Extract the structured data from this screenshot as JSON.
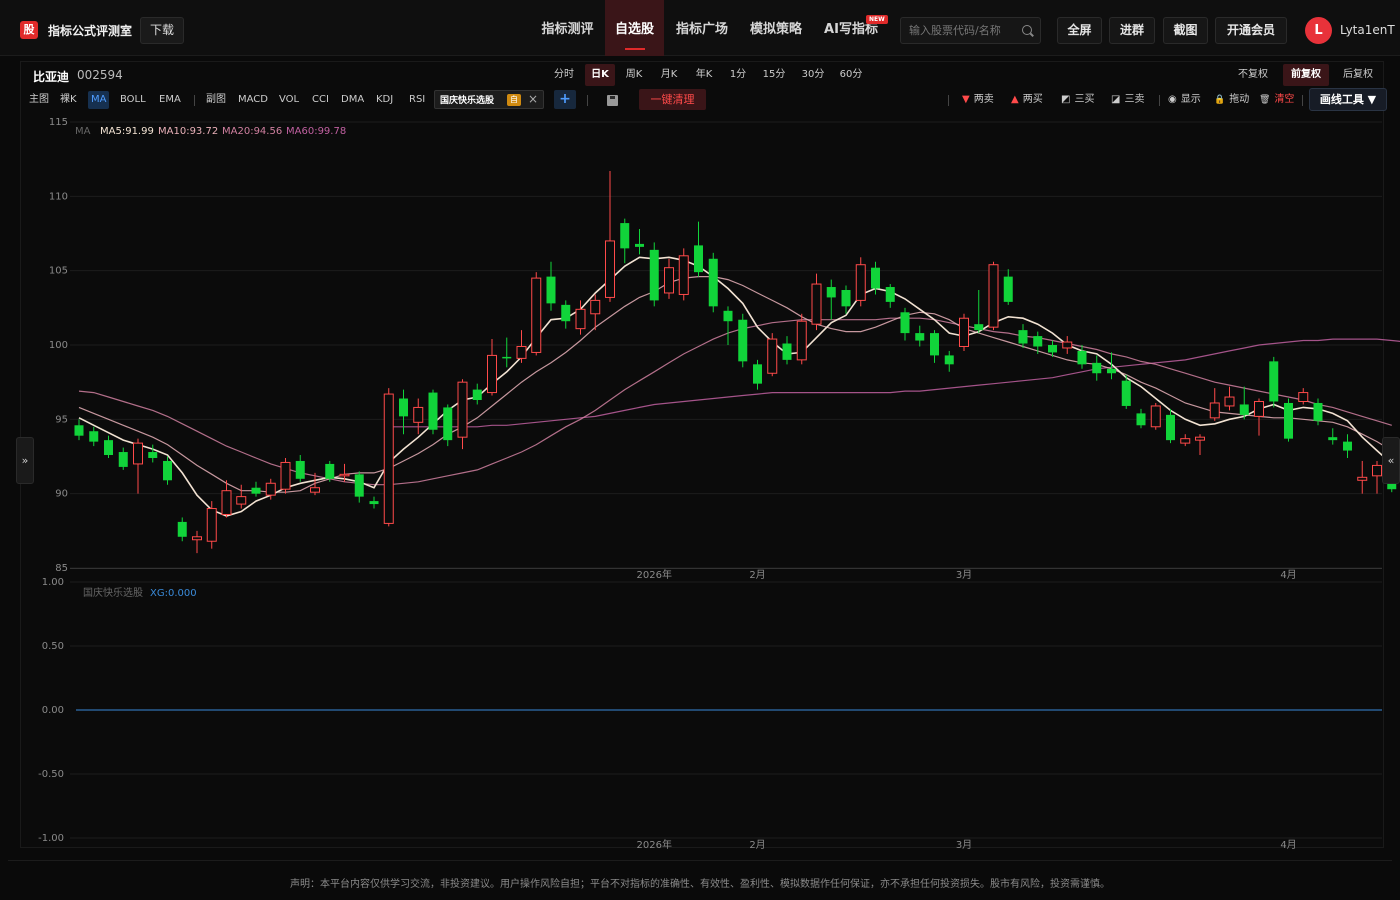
{
  "app": {
    "logo_char": "股",
    "title": "指标公式评测室",
    "download_label": "下载"
  },
  "nav": {
    "items": [
      "指标测评",
      "自选股",
      "指标广场",
      "模拟策略",
      "AI写指标"
    ],
    "active_index": 1,
    "new_badge": "NEW"
  },
  "search": {
    "placeholder": "输入股票代码/名称"
  },
  "top_buttons": [
    "全屏",
    "进群",
    "截图",
    "开通会员"
  ],
  "user": {
    "avatar_letter": "L",
    "name": "Lyta1enT"
  },
  "stock": {
    "name": "比亚迪",
    "code": "002594"
  },
  "periods": [
    "分时",
    "日K",
    "周K",
    "月K",
    "年K",
    "1分",
    "15分",
    "30分",
    "60分"
  ],
  "period_active": "日K",
  "adjust": [
    "不复权",
    "前复权",
    "后复权"
  ],
  "adjust_active": "前复权",
  "indicators_main": [
    "主图",
    "裸K",
    "MA",
    "BOLL",
    "EMA"
  ],
  "indicators_main_active": "MA",
  "indicators_sub": [
    "副图",
    "MACD",
    "VOL",
    "CCI",
    "DMA",
    "KDJ",
    "RSI"
  ],
  "custom_indicator": {
    "name": "国庆快乐选股",
    "badge": "自",
    "close": "×"
  },
  "add_indicator": "+",
  "clear_all": "一键清理",
  "draw_tools": [
    {
      "icon": "▼",
      "color": "#ff4a4a",
      "label": "两卖"
    },
    {
      "icon": "▲",
      "color": "#ff4a4a",
      "label": "两买"
    },
    {
      "icon": "◩",
      "color": "#cccccc",
      "label": "三买"
    },
    {
      "icon": "◪",
      "color": "#cccccc",
      "label": "三卖"
    },
    {
      "icon": "◉",
      "color": "#cccccc",
      "label": "显示"
    },
    {
      "icon": "🔒",
      "color": "#e0a030",
      "label": "拖动"
    },
    {
      "icon": "🗑",
      "color": "#cccccc",
      "label": "清空"
    }
  ],
  "draw_tools_button": "画线工具 ▼",
  "ma_legend": {
    "label": "MA",
    "items": [
      {
        "text": "MA5:91.99",
        "color": "#f2e2d2"
      },
      {
        "text": "MA10:93.72",
        "color": "#e8b0b8"
      },
      {
        "text": "MA20:94.56",
        "color": "#d080a0"
      },
      {
        "text": "MA60:99.78",
        "color": "#c060a0"
      }
    ]
  },
  "sub_legend": {
    "name": "国庆快乐选股",
    "value": "XG:0.000"
  },
  "collapse_left": "»",
  "collapse_right": "«",
  "disclaimer": "声明：本平台内容仅供学习交流，非投资建议。用户操作风险自担；平台不对指标的准确性、有效性、盈利性、模拟数据作任何保证，亦不承担任何投资损失。股市有风险，投资需谨慎。",
  "colors": {
    "up": "#ff4a4a",
    "down": "#11d43a",
    "accent": "#e02a2a",
    "ma5": "#f2e2d2",
    "ma10": "#e8b0b8",
    "ma20": "#d080a0",
    "ma60": "#c060a0",
    "xg": "#3a8ad8"
  },
  "chart_data": [
    {
      "type": "candlestick",
      "ylim": [
        85,
        115
      ],
      "y_ticks": [
        115,
        110,
        105,
        100,
        95,
        90,
        85
      ],
      "x_labels": [
        {
          "label": "2026年",
          "index": 39
        },
        {
          "label": "2月",
          "index": 46
        },
        {
          "label": "3月",
          "index": 60
        },
        {
          "label": "4月",
          "index": 82
        }
      ],
      "candles": [
        {
          "o": 94.6,
          "c": 93.9,
          "h": 95.0,
          "l": 93.6
        },
        {
          "o": 94.2,
          "c": 93.5,
          "h": 94.5,
          "l": 93.2
        },
        {
          "o": 93.6,
          "c": 92.6,
          "h": 93.9,
          "l": 92.4
        },
        {
          "o": 92.8,
          "c": 91.8,
          "h": 93.1,
          "l": 91.6
        },
        {
          "o": 92.0,
          "c": 93.4,
          "h": 93.7,
          "l": 90.0
        },
        {
          "o": 92.8,
          "c": 92.4,
          "h": 93.3,
          "l": 92.1
        },
        {
          "o": 92.2,
          "c": 90.9,
          "h": 92.5,
          "l": 90.6
        },
        {
          "o": 88.1,
          "c": 87.1,
          "h": 88.4,
          "l": 86.8
        },
        {
          "o": 86.9,
          "c": 87.1,
          "h": 87.5,
          "l": 86.0
        },
        {
          "o": 86.8,
          "c": 89.0,
          "h": 89.5,
          "l": 86.3
        },
        {
          "o": 88.6,
          "c": 90.2,
          "h": 90.9,
          "l": 88.4
        },
        {
          "o": 89.3,
          "c": 89.8,
          "h": 90.6,
          "l": 89.0
        },
        {
          "o": 90.4,
          "c": 90.0,
          "h": 90.8,
          "l": 89.8
        },
        {
          "o": 89.9,
          "c": 90.7,
          "h": 91.0,
          "l": 89.6
        },
        {
          "o": 90.3,
          "c": 92.1,
          "h": 92.4,
          "l": 90.0
        },
        {
          "o": 92.2,
          "c": 91.0,
          "h": 92.6,
          "l": 90.8
        },
        {
          "o": 90.1,
          "c": 90.4,
          "h": 91.4,
          "l": 89.9
        },
        {
          "o": 92.0,
          "c": 91.0,
          "h": 92.2,
          "l": 90.8
        },
        {
          "o": 91.2,
          "c": 91.3,
          "h": 92.0,
          "l": 90.8
        },
        {
          "o": 91.3,
          "c": 89.8,
          "h": 91.5,
          "l": 89.4
        },
        {
          "o": 89.5,
          "c": 89.3,
          "h": 89.8,
          "l": 89.0
        },
        {
          "o": 88.0,
          "c": 96.7,
          "h": 97.1,
          "l": 87.8
        },
        {
          "o": 96.4,
          "c": 95.2,
          "h": 97.0,
          "l": 94.0
        },
        {
          "o": 94.8,
          "c": 95.8,
          "h": 96.4,
          "l": 94.0
        },
        {
          "o": 96.8,
          "c": 94.3,
          "h": 97.0,
          "l": 94.0
        },
        {
          "o": 95.8,
          "c": 93.6,
          "h": 96.0,
          "l": 93.2
        },
        {
          "o": 93.8,
          "c": 97.5,
          "h": 97.7,
          "l": 93.0
        },
        {
          "o": 97.0,
          "c": 96.3,
          "h": 97.4,
          "l": 96.0
        },
        {
          "o": 96.8,
          "c": 99.3,
          "h": 100.4,
          "l": 96.6
        },
        {
          "o": 99.2,
          "c": 99.1,
          "h": 100.5,
          "l": 98.5
        },
        {
          "o": 99.1,
          "c": 99.9,
          "h": 101.0,
          "l": 98.8
        },
        {
          "o": 99.5,
          "c": 104.5,
          "h": 104.9,
          "l": 99.3
        },
        {
          "o": 104.6,
          "c": 102.8,
          "h": 105.6,
          "l": 102.3
        },
        {
          "o": 102.7,
          "c": 101.6,
          "h": 103.0,
          "l": 101.1
        },
        {
          "o": 101.1,
          "c": 102.4,
          "h": 103.0,
          "l": 100.7
        },
        {
          "o": 102.1,
          "c": 103.0,
          "h": 103.4,
          "l": 101.0
        },
        {
          "o": 103.2,
          "c": 107.0,
          "h": 111.7,
          "l": 102.9
        },
        {
          "o": 108.2,
          "c": 106.5,
          "h": 108.5,
          "l": 105.5
        },
        {
          "o": 106.8,
          "c": 106.6,
          "h": 107.8,
          "l": 106.1
        },
        {
          "o": 106.4,
          "c": 103.0,
          "h": 106.9,
          "l": 102.6
        },
        {
          "o": 103.5,
          "c": 105.2,
          "h": 105.8,
          "l": 103.1
        },
        {
          "o": 103.4,
          "c": 106.0,
          "h": 106.5,
          "l": 103.0
        },
        {
          "o": 106.7,
          "c": 104.9,
          "h": 108.3,
          "l": 104.6
        },
        {
          "o": 105.8,
          "c": 102.6,
          "h": 106.2,
          "l": 102.2
        },
        {
          "o": 102.3,
          "c": 101.6,
          "h": 102.6,
          "l": 100.0
        },
        {
          "o": 101.7,
          "c": 98.9,
          "h": 102.1,
          "l": 98.5
        },
        {
          "o": 98.7,
          "c": 97.4,
          "h": 99.0,
          "l": 97.0
        },
        {
          "o": 98.1,
          "c": 100.4,
          "h": 100.8,
          "l": 97.9
        },
        {
          "o": 100.1,
          "c": 99.0,
          "h": 100.6,
          "l": 98.7
        },
        {
          "o": 99.0,
          "c": 101.6,
          "h": 102.1,
          "l": 98.7
        },
        {
          "o": 101.4,
          "c": 104.1,
          "h": 104.8,
          "l": 101.0
        },
        {
          "o": 103.9,
          "c": 103.2,
          "h": 104.4,
          "l": 101.7
        },
        {
          "o": 103.7,
          "c": 102.6,
          "h": 104.0,
          "l": 102.1
        },
        {
          "o": 103.0,
          "c": 105.4,
          "h": 105.9,
          "l": 102.6
        },
        {
          "o": 105.2,
          "c": 103.8,
          "h": 105.6,
          "l": 103.4
        },
        {
          "o": 103.9,
          "c": 102.9,
          "h": 104.1,
          "l": 102.5
        },
        {
          "o": 102.2,
          "c": 100.8,
          "h": 102.5,
          "l": 100.3
        },
        {
          "o": 100.8,
          "c": 100.3,
          "h": 101.3,
          "l": 99.9
        },
        {
          "o": 100.8,
          "c": 99.3,
          "h": 101.0,
          "l": 98.8
        },
        {
          "o": 99.3,
          "c": 98.7,
          "h": 99.6,
          "l": 98.2
        },
        {
          "o": 99.9,
          "c": 101.8,
          "h": 102.1,
          "l": 99.6
        },
        {
          "o": 101.4,
          "c": 101.0,
          "h": 103.7,
          "l": 100.8
        },
        {
          "o": 101.2,
          "c": 105.4,
          "h": 105.6,
          "l": 101.0
        },
        {
          "o": 104.6,
          "c": 102.9,
          "h": 105.1,
          "l": 102.7
        },
        {
          "o": 101.0,
          "c": 100.1,
          "h": 101.4,
          "l": 99.8
        },
        {
          "o": 100.6,
          "c": 99.9,
          "h": 100.9,
          "l": 99.4
        },
        {
          "o": 100.0,
          "c": 99.5,
          "h": 100.3,
          "l": 99.2
        },
        {
          "o": 99.8,
          "c": 100.2,
          "h": 100.6,
          "l": 99.4
        },
        {
          "o": 99.6,
          "c": 98.7,
          "h": 100.0,
          "l": 98.4
        },
        {
          "o": 98.8,
          "c": 98.1,
          "h": 99.3,
          "l": 97.6
        },
        {
          "o": 98.4,
          "c": 98.1,
          "h": 99.5,
          "l": 97.7
        },
        {
          "o": 97.6,
          "c": 95.9,
          "h": 98.0,
          "l": 95.7
        },
        {
          "o": 95.4,
          "c": 94.6,
          "h": 95.7,
          "l": 94.4
        },
        {
          "o": 94.5,
          "c": 95.9,
          "h": 96.1,
          "l": 94.3
        },
        {
          "o": 95.3,
          "c": 93.6,
          "h": 95.7,
          "l": 93.4
        },
        {
          "o": 93.4,
          "c": 93.7,
          "h": 94.0,
          "l": 93.2
        },
        {
          "o": 93.6,
          "c": 93.8,
          "h": 94.0,
          "l": 92.6
        },
        {
          "o": 95.1,
          "c": 96.1,
          "h": 97.1,
          "l": 94.9
        },
        {
          "o": 95.9,
          "c": 96.5,
          "h": 97.2,
          "l": 95.6
        },
        {
          "o": 96.0,
          "c": 95.3,
          "h": 97.2,
          "l": 95.0
        },
        {
          "o": 95.2,
          "c": 96.2,
          "h": 96.4,
          "l": 93.9
        },
        {
          "o": 98.9,
          "c": 96.2,
          "h": 99.2,
          "l": 95.8
        },
        {
          "o": 96.1,
          "c": 93.7,
          "h": 96.4,
          "l": 93.5
        },
        {
          "o": 96.2,
          "c": 96.8,
          "h": 97.1,
          "l": 96.0
        },
        {
          "o": 96.1,
          "c": 94.9,
          "h": 96.4,
          "l": 94.6
        },
        {
          "o": 93.8,
          "c": 93.6,
          "h": 94.4,
          "l": 93.3
        },
        {
          "o": 93.5,
          "c": 92.9,
          "h": 94.0,
          "l": 92.4
        },
        {
          "o": 90.9,
          "c": 91.1,
          "h": 92.2,
          "l": 90.0
        },
        {
          "o": 91.2,
          "c": 91.9,
          "h": 92.2,
          "l": 90.0
        },
        {
          "o": 90.8,
          "c": 90.3,
          "h": 91.0,
          "l": 90.1
        }
      ],
      "ma5": [
        95.1,
        94.6,
        94.1,
        93.6,
        93.3,
        93.0,
        92.6,
        91.4,
        89.9,
        88.9,
        88.5,
        88.8,
        89.5,
        89.9,
        90.4,
        90.7,
        90.9,
        91.1,
        91.0,
        90.8,
        90.4,
        92.1,
        93.0,
        93.8,
        94.7,
        95.6,
        96.3,
        96.5,
        97.4,
        98.2,
        99.2,
        100.5,
        101.7,
        101.8,
        102.4,
        103.5,
        104.4,
        105.3,
        105.9,
        105.8,
        105.9,
        105.7,
        105.3,
        104.6,
        103.8,
        102.8,
        101.2,
        100.2,
        99.4,
        99.5,
        100.5,
        101.5,
        102.0,
        103.4,
        103.8,
        103.6,
        103.1,
        102.4,
        101.7,
        100.8,
        100.6,
        100.9,
        101.5,
        101.9,
        101.8,
        101.4,
        100.8,
        100.0,
        99.6,
        99.4,
        98.7,
        97.8,
        97.2,
        96.4,
        95.6,
        95.0,
        94.6,
        94.7,
        95.0,
        95.2,
        95.7,
        96.0,
        95.6,
        95.8,
        95.7,
        95.4,
        94.9,
        93.8,
        92.9,
        92.0
      ],
      "ma10": [
        95.8,
        95.4,
        95.0,
        94.6,
        94.2,
        93.8,
        93.3,
        92.6,
        91.9,
        91.3,
        90.7,
        90.2,
        90.2,
        90.1,
        90.1,
        90.2,
        90.7,
        91.0,
        91.3,
        91.4,
        91.4,
        91.7,
        92.2,
        92.7,
        93.3,
        94.0,
        94.5,
        95.1,
        95.9,
        96.7,
        97.5,
        98.2,
        98.8,
        99.5,
        100.3,
        101.2,
        101.9,
        102.6,
        103.2,
        103.6,
        104.2,
        104.5,
        104.6,
        104.6,
        104.4,
        104.0,
        103.5,
        103.0,
        102.5,
        101.9,
        101.4,
        101.1,
        100.9,
        100.9,
        101.2,
        101.6,
        102.0,
        102.2,
        102.1,
        101.7,
        101.1,
        100.8,
        100.5,
        100.2,
        99.9,
        99.6,
        99.3,
        99.0,
        98.8,
        98.7,
        98.4,
        98.0,
        97.5,
        97.1,
        96.6,
        96.1,
        95.8,
        95.5,
        95.4,
        95.3,
        95.2,
        95.1,
        95.1,
        95.0,
        94.9,
        94.8,
        94.5,
        94.0,
        93.5,
        92.9
      ],
      "ma20": [
        96.9,
        96.8,
        96.5,
        96.2,
        95.9,
        95.6,
        95.2,
        94.7,
        94.2,
        93.7,
        93.2,
        92.8,
        92.4,
        92.0,
        91.7,
        91.4,
        91.2,
        91.0,
        90.8,
        90.7,
        90.6,
        90.6,
        90.7,
        90.8,
        91.0,
        91.2,
        91.4,
        91.6,
        92.0,
        92.4,
        92.8,
        93.3,
        93.9,
        94.5,
        95.0,
        95.6,
        96.3,
        97.0,
        97.6,
        98.2,
        98.8,
        99.4,
        99.9,
        100.4,
        100.8,
        101.1,
        101.3,
        101.5,
        101.6,
        101.7,
        101.7,
        101.7,
        101.7,
        101.7,
        101.7,
        101.8,
        101.8,
        101.8,
        101.7,
        101.5,
        101.3,
        101.1,
        100.9,
        100.8,
        100.6,
        100.5,
        100.3,
        100.1,
        99.9,
        99.7,
        99.4,
        99.2,
        98.9,
        98.7,
        98.4,
        98.1,
        97.8,
        97.5,
        97.3,
        97.1,
        96.9,
        96.7,
        96.5,
        96.3,
        96.0,
        95.8,
        95.5,
        95.2,
        94.9,
        94.6
      ],
      "ma60_start_index": 21,
      "ma60": [
        94.5,
        94.5,
        94.5,
        94.5,
        94.5,
        94.5,
        94.5,
        94.6,
        94.6,
        94.7,
        94.8,
        94.9,
        95.0,
        95.1,
        95.2,
        95.4,
        95.6,
        95.8,
        96.0,
        96.1,
        96.2,
        96.3,
        96.4,
        96.5,
        96.6,
        96.7,
        96.8,
        96.8,
        96.8,
        96.8,
        96.8,
        96.8,
        96.8,
        96.8,
        96.8,
        96.9,
        96.9,
        97.0,
        97.1,
        97.2,
        97.3,
        97.4,
        97.5,
        97.6,
        97.7,
        97.8,
        98.0,
        98.2,
        98.4,
        98.5,
        98.6,
        98.7,
        98.8,
        98.9,
        99.0,
        99.2,
        99.4,
        99.6,
        99.8,
        100.0,
        100.1,
        100.2,
        100.3,
        100.3,
        100.4,
        100.4,
        100.4,
        100.4,
        100.3,
        100.2
      ]
    },
    {
      "type": "line",
      "ylim": [
        -1,
        1
      ],
      "y_ticks": [
        1.0,
        0.5,
        0.0,
        -0.5,
        -1.0
      ],
      "y_tick_labels": [
        "1.00",
        "0.50",
        "0.00",
        "-0.50",
        "-1.00"
      ],
      "series": [
        {
          "name": "XG",
          "value": 0.0
        }
      ]
    }
  ]
}
